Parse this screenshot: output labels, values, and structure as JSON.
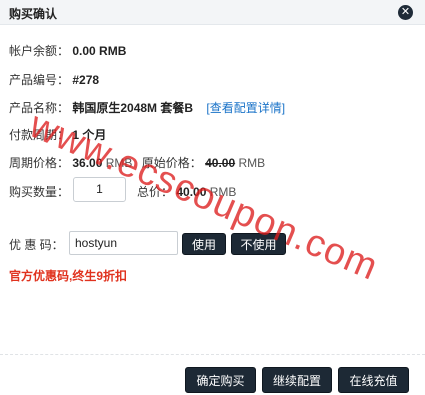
{
  "dialog": {
    "title": "购买确认",
    "close_icon": "✕"
  },
  "fields": {
    "balance_label": "帐户余额：",
    "balance_value": "0.00 RMB",
    "product_no_label": "产品编号：",
    "product_no_value": "#278",
    "product_name_label": "产品名称：",
    "product_name_value": "韩国原生2048M 套餐B",
    "product_detail_link": "[查看配置详情]",
    "period_label": "付款周期：",
    "period_value": "1 个月",
    "period_price_label": "周期价格：",
    "period_price_value": "36.00",
    "period_price_unit": "RMB",
    "orig_price_label": "原始价格：",
    "orig_price_value": "40.00",
    "orig_price_unit": "RMB",
    "qty_label": "购买数量：",
    "qty_value": "1",
    "total_label": "总价：",
    "total_value": "40.00",
    "total_unit": "RMB"
  },
  "coupon": {
    "label": "优 惠 码：",
    "value": "hostyun",
    "use_button": "使用",
    "no_use_button": "不使用",
    "promo_text": "官方优惠码,终生9折扣"
  },
  "footer": {
    "confirm_button": "确定购买",
    "continue_button": "继续配置",
    "recharge_button": "在线充值"
  },
  "watermark": {
    "text": "www.ecscoupon.com"
  }
}
